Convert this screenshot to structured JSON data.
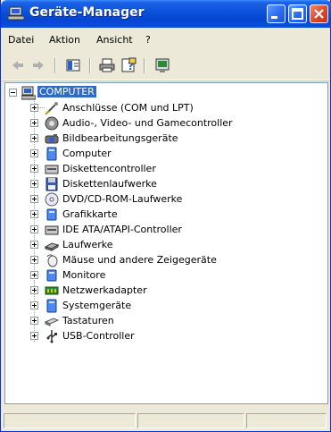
{
  "window": {
    "title": "Geräte-Manager",
    "title_icon": "device-manager-icon"
  },
  "menu": [
    {
      "label": "Datei",
      "name": "menu-datei"
    },
    {
      "label": "Aktion",
      "name": "menu-aktion"
    },
    {
      "label": "Ansicht",
      "name": "menu-ansicht"
    },
    {
      "label": "?",
      "name": "menu-help"
    }
  ],
  "toolbar": {
    "buttons": [
      "back-arrow-icon",
      "forward-arrow-icon",
      "show-hide-console-tree-icon",
      "print-icon",
      "properties-help-icon",
      "device-manager-view-icon"
    ]
  },
  "tree": {
    "root": {
      "label": "COMPUTER",
      "icon": "computer-icon",
      "expanded": true,
      "selected": true
    },
    "items": [
      {
        "label": "Anschlüsse (COM und LPT)",
        "icon": "port-icon"
      },
      {
        "label": "Audio-, Video- und Gamecontroller",
        "icon": "audio-icon"
      },
      {
        "label": "Bildbearbeitungsgeräte",
        "icon": "camera-icon"
      },
      {
        "label": "Computer",
        "icon": "computer-icon"
      },
      {
        "label": "Diskettencontroller",
        "icon": "floppy-controller-icon"
      },
      {
        "label": "Diskettenlaufwerke",
        "icon": "floppy-drive-icon"
      },
      {
        "label": "DVD/CD-ROM-Laufwerke",
        "icon": "cd-drive-icon"
      },
      {
        "label": "Grafikkarte",
        "icon": "display-adapter-icon"
      },
      {
        "label": "IDE ATA/ATAPI-Controller",
        "icon": "ide-controller-icon"
      },
      {
        "label": "Laufwerke",
        "icon": "disk-drive-icon"
      },
      {
        "label": "Mäuse und andere Zeigegeräte",
        "icon": "mouse-icon"
      },
      {
        "label": "Monitore",
        "icon": "monitor-icon"
      },
      {
        "label": "Netzwerkadapter",
        "icon": "network-adapter-icon"
      },
      {
        "label": "Systemgeräte",
        "icon": "system-device-icon"
      },
      {
        "label": "Tastaturen",
        "icon": "keyboard-icon"
      },
      {
        "label": "USB-Controller",
        "icon": "usb-icon"
      }
    ]
  },
  "colors": {
    "title_bar": "#0a50d8",
    "selection": "#316ac5",
    "window_face": "#ece9d8",
    "close_button": "#d8482a"
  }
}
